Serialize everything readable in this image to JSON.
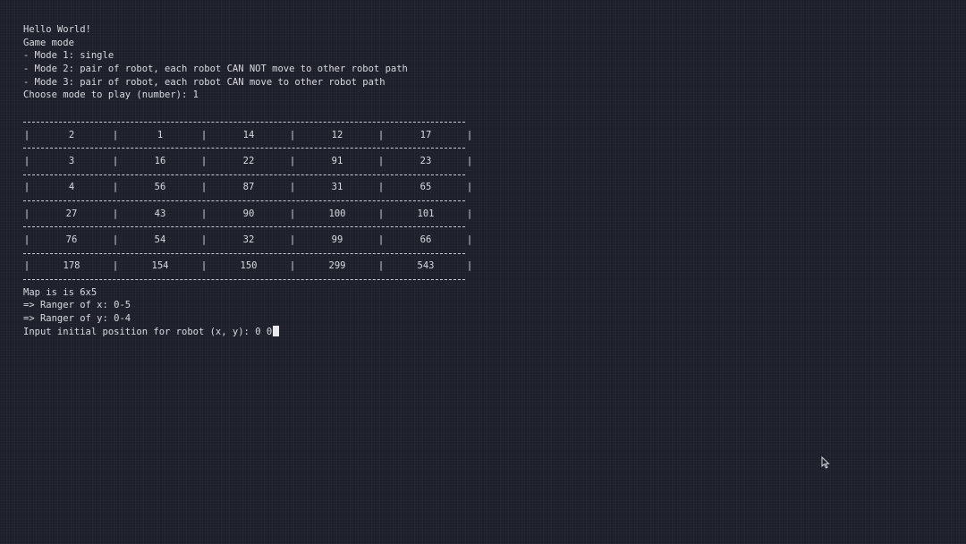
{
  "intro_lines": [
    "Hello World!",
    "Game mode",
    "- Mode 1: single",
    "- Mode 2: pair of robot, each robot CAN NOT move to other robot path",
    "- Mode 3: pair of robot, each robot CAN move to other robot path",
    "Choose mode to play (number): 1"
  ],
  "grid": {
    "rows": [
      [
        "2",
        "1",
        "14",
        "12",
        "17"
      ],
      [
        "3",
        "16",
        "22",
        "91",
        "23"
      ],
      [
        "4",
        "56",
        "87",
        "31",
        "65"
      ],
      [
        "27",
        "43",
        "90",
        "100",
        "101"
      ],
      [
        "76",
        "54",
        "32",
        "99",
        "66"
      ],
      [
        "178",
        "154",
        "150",
        "299",
        "543"
      ]
    ],
    "bar_char": "|"
  },
  "outro_lines": [
    "Map is is 6x5",
    "=> Ranger of x: 0-5",
    "=> Ranger of y: 0-4"
  ],
  "prompt": {
    "text": "Input initial position for robot (x, y): ",
    "input_value": "0 0"
  }
}
